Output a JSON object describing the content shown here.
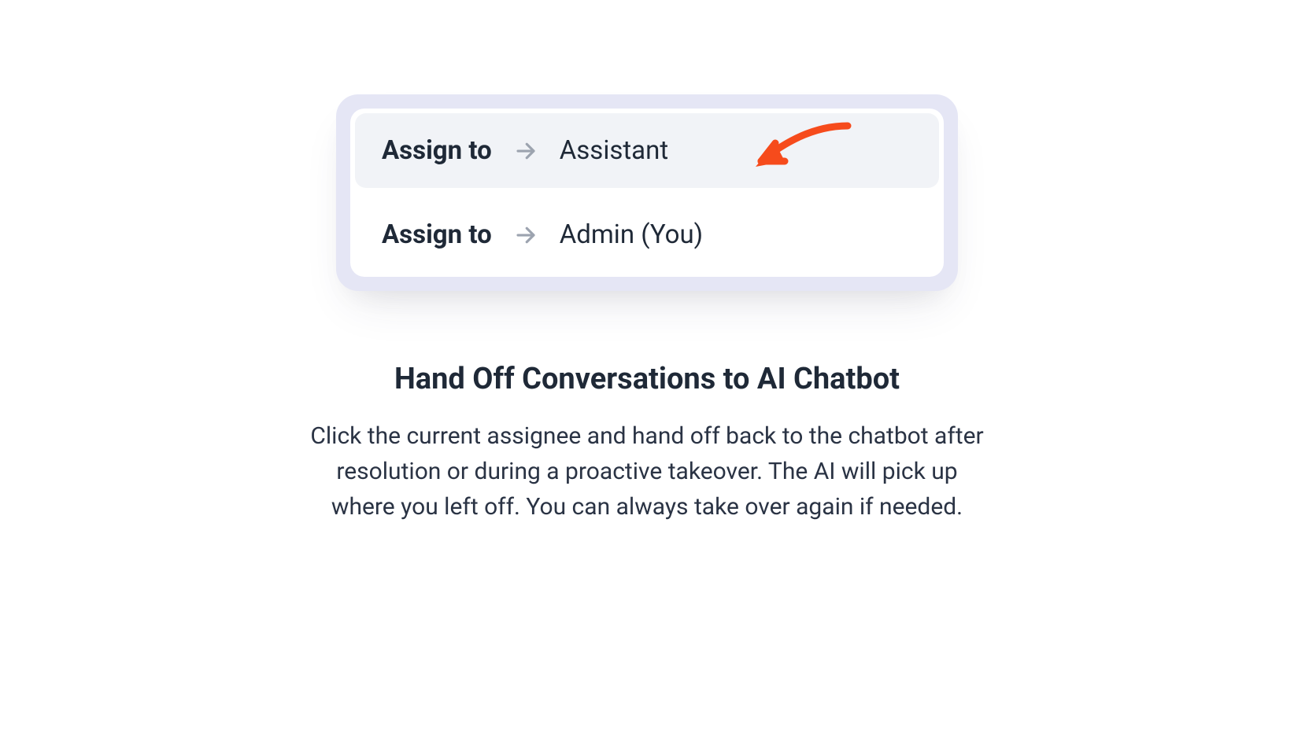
{
  "options": [
    {
      "label": "Assign to",
      "value": "Assistant",
      "selected": true
    },
    {
      "label": "Assign to",
      "value": "Admin (You)",
      "selected": false
    }
  ],
  "heading": "Hand Off Conversations to AI Chatbot",
  "description": "Click the current assignee and hand off back to the chatbot after resolution or during a proactive takeover. The AI will pick up where you left off. You can always take over again if needed."
}
